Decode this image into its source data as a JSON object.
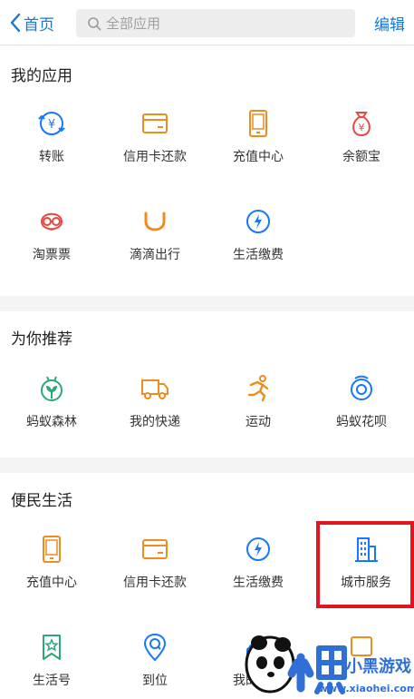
{
  "header": {
    "back_label": "首页",
    "search_placeholder": "全部应用",
    "edit_label": "编辑"
  },
  "sections": {
    "my_apps": {
      "title": "我的应用",
      "items": [
        {
          "label": "转账",
          "icon": "transfer-icon"
        },
        {
          "label": "信用卡还款",
          "icon": "credit-card-icon"
        },
        {
          "label": "充值中心",
          "icon": "phone-recharge-icon"
        },
        {
          "label": "余额宝",
          "icon": "money-bag-icon"
        },
        {
          "label": "淘票票",
          "icon": "glasses-face-icon"
        },
        {
          "label": "滴滴出行",
          "icon": "didi-icon"
        },
        {
          "label": "生活缴费",
          "icon": "water-drop-icon"
        }
      ]
    },
    "recommended": {
      "title": "为你推荐",
      "items": [
        {
          "label": "蚂蚁森林",
          "icon": "forest-icon"
        },
        {
          "label": "我的快递",
          "icon": "delivery-truck-icon"
        },
        {
          "label": "运动",
          "icon": "running-icon"
        },
        {
          "label": "蚂蚁花呗",
          "icon": "huabei-icon"
        }
      ]
    },
    "convenience": {
      "title": "便民生活",
      "items": [
        {
          "label": "充值中心",
          "icon": "phone-recharge-icon"
        },
        {
          "label": "信用卡还款",
          "icon": "credit-card-icon"
        },
        {
          "label": "生活缴费",
          "icon": "water-drop-icon"
        },
        {
          "label": "城市服务",
          "icon": "city-building-icon"
        },
        {
          "label": "生活号",
          "icon": "bookmark-star-icon"
        },
        {
          "label": "到位",
          "icon": "location-pin-icon"
        },
        {
          "label": "我的客服",
          "icon": "customer-service-icon"
        },
        {
          "label": "",
          "icon": "partial-icon"
        }
      ]
    }
  },
  "watermark": {
    "text": "小黑游戏",
    "url": "www.xiaohei.com"
  },
  "colors": {
    "accent_blue": "#1976d2",
    "icon_orange": "#f08b1e",
    "icon_red": "#e8473f",
    "icon_green": "#2aa876",
    "icon_blue": "#1677ff",
    "highlight_red": "#e3141b"
  }
}
